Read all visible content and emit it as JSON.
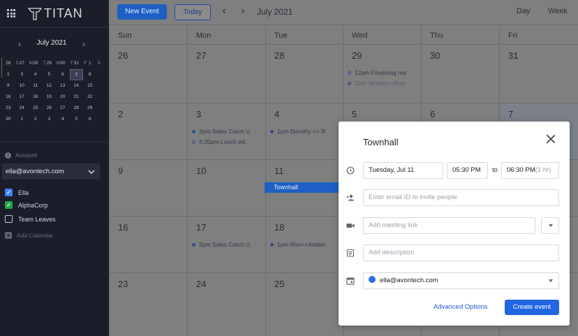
{
  "app": {
    "name": "TITAN"
  },
  "sidebar": {
    "mini_calendar": {
      "title": "July 2021",
      "dow": [
        "S",
        "M",
        "T",
        "W",
        "T",
        "F",
        "S"
      ],
      "weeks": [
        [
          "26",
          "27",
          "28",
          "29",
          "30",
          "31",
          "1"
        ],
        [
          "2",
          "3",
          "4",
          "5",
          "6",
          "7",
          "8"
        ],
        [
          "9",
          "10",
          "11",
          "12",
          "13",
          "14",
          "15"
        ],
        [
          "16",
          "17",
          "18",
          "19",
          "20",
          "21",
          "22"
        ],
        [
          "23",
          "24",
          "25",
          "26",
          "27",
          "28",
          "29"
        ],
        [
          "30",
          "1",
          "2",
          "3",
          "4",
          "5",
          "6"
        ]
      ],
      "selected": "7"
    },
    "account_label": "Account",
    "account_value": "ella@avontech.com",
    "calendars": [
      {
        "label": "Ella",
        "checked": true,
        "color": "#3b82f6"
      },
      {
        "label": "AlphaCorp",
        "checked": true,
        "color": "#22a447"
      },
      {
        "label": "Team Leaves",
        "checked": false,
        "color": ""
      }
    ],
    "add_calendar": "Add Calendar"
  },
  "toolbar": {
    "new_event": "New Event",
    "today": "Today",
    "month_label": "July 2021",
    "view_day": "Day",
    "view_week": "Week"
  },
  "calendar": {
    "days_of_week": [
      "Sun",
      "Mon",
      "Tue",
      "Wed",
      "Thu",
      "Fri"
    ],
    "weeks": [
      [
        {
          "num": "26",
          "events": []
        },
        {
          "num": "27",
          "events": []
        },
        {
          "num": "28",
          "events": []
        },
        {
          "num": "29",
          "events": [
            {
              "text": "12pm Finalising rep",
              "style": "hollow"
            },
            {
              "text": "2pm Jeremy<>Ron",
              "style": "faint"
            }
          ]
        },
        {
          "num": "30",
          "events": []
        },
        {
          "num": "31",
          "events": []
        }
      ],
      [
        {
          "num": "2",
          "events": []
        },
        {
          "num": "3",
          "events": [
            {
              "text": "3pm Sales Catch U",
              "style": "solid"
            },
            {
              "text": "4:30pm Lunch wit",
              "style": "hollow"
            }
          ]
        },
        {
          "num": "4",
          "events": [
            {
              "text": "1pm Dorothy <> R",
              "style": "solid"
            }
          ]
        },
        {
          "num": "5",
          "events": []
        },
        {
          "num": "6",
          "events": []
        },
        {
          "num": "7",
          "events": []
        }
      ],
      [
        {
          "num": "9",
          "events": []
        },
        {
          "num": "10",
          "events": []
        },
        {
          "num": "11",
          "events": []
        },
        {
          "num": "",
          "events": []
        },
        {
          "num": "",
          "events": []
        },
        {
          "num": "",
          "events": []
        }
      ],
      [
        {
          "num": "16",
          "events": []
        },
        {
          "num": "17",
          "events": [
            {
              "text": "2pm Sales Catch U",
              "style": "solid"
            }
          ]
        },
        {
          "num": "18",
          "events": [
            {
              "text": "1pm Ron<>Amber",
              "style": "solid"
            }
          ]
        },
        {
          "num": "",
          "events": []
        },
        {
          "num": "",
          "events": []
        },
        {
          "num": "",
          "events": []
        }
      ],
      [
        {
          "num": "23",
          "events": []
        },
        {
          "num": "24",
          "events": []
        },
        {
          "num": "25",
          "events": []
        },
        {
          "num": "",
          "events": []
        },
        {
          "num": "",
          "events": []
        },
        {
          "num": "",
          "events": []
        }
      ]
    ],
    "bar_event": "Townhall"
  },
  "modal": {
    "title": "Townhall",
    "date": "Tuesday, Jul 11",
    "start": "05:30 PM",
    "to": "to",
    "end": "06:30 PM",
    "duration": "(1 hr)",
    "invite_placeholder": "Enter email ID to invite people",
    "link_placeholder": "Add meeting link",
    "description_placeholder": "Add description",
    "calendar": "ella@avontech.com",
    "advanced": "Advanced Options",
    "create": "Create event"
  }
}
